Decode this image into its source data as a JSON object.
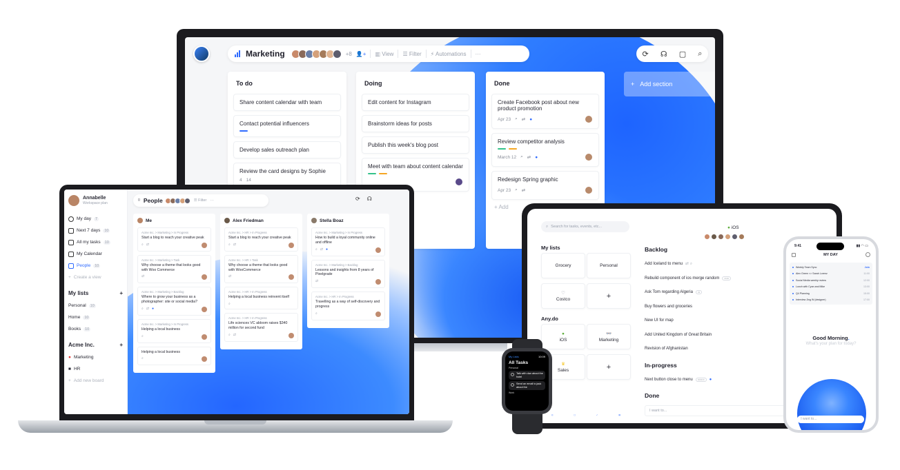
{
  "colors": {
    "accent": "#2f6bff",
    "text": "#1e1e2a",
    "muted": "#9aa0ad"
  },
  "monitor": {
    "project_title": "Marketing",
    "more_members": "+8",
    "view_label": "View",
    "filter_label": "Filter",
    "automations_label": "Automations",
    "more_label": "···",
    "add_section_label": "Add section",
    "columns": [
      {
        "title": "To do",
        "cards": [
          {
            "text": "Share content calendar with team"
          },
          {
            "text": "Contact potential influencers"
          },
          {
            "text": "Develop sales outreach plan"
          },
          {
            "text": "Review the card designs by Sophie",
            "meta1": "4",
            "meta2": "14"
          }
        ]
      },
      {
        "title": "Doing",
        "cards": [
          {
            "text": "Edit content for Instagram"
          },
          {
            "text": "Brainstorm ideas for posts"
          },
          {
            "text": "Publish this week's blog post"
          },
          {
            "text": "Meet with team about content calendar"
          }
        ]
      },
      {
        "title": "Done",
        "cards": [
          {
            "text": "Create Facebook post about new product promotion",
            "date": "Apr 23"
          },
          {
            "text": "Review competitor analysis",
            "date": "March 12"
          },
          {
            "text": "Redesign Spring graphic",
            "date": "Apr 23"
          }
        ],
        "add_label": "Add"
      }
    ]
  },
  "laptop": {
    "user_name": "Annabelle",
    "user_plan": "Workspace plan",
    "nav": [
      {
        "label": "My day",
        "count": "7"
      },
      {
        "label": "Next 7 days",
        "count": "10"
      },
      {
        "label": "All my tasks",
        "count": "10"
      },
      {
        "label": "My Calendar",
        "count": ""
      },
      {
        "label": "People",
        "count": "10"
      },
      {
        "label": "Create a view",
        "count": ""
      }
    ],
    "my_lists_title": "My lists",
    "my_lists": [
      {
        "label": "Personal",
        "count": "10"
      },
      {
        "label": "Home",
        "count": "10"
      },
      {
        "label": "Books",
        "count": "10"
      }
    ],
    "workspace_title": "Acme Inc.",
    "workspace_items": [
      {
        "label": "Marketing"
      },
      {
        "label": "HR"
      },
      {
        "label": "Add new board"
      }
    ],
    "board_title": "People",
    "filter_label": "Filter",
    "more_label": "···",
    "columns": [
      {
        "person": "Me",
        "cards": [
          {
            "crumb": "Acme Inc. > Marketing > In Progress",
            "text": "Start a blog to reach your creative peak"
          },
          {
            "crumb": "Acme Inc. > Marketing > Task",
            "text": "Why choose a theme that looks good with Woo Commerce"
          },
          {
            "crumb": "Acme Inc. > Marketing > Backlog",
            "text": "Where to grow your business as a photographer: site or social media?"
          },
          {
            "crumb": "Acme Inc. > Marketing > In Progress",
            "text": "Helping a local business"
          },
          {
            "crumb": "",
            "text": "Helping a local business"
          }
        ]
      },
      {
        "person": "Alex Friedman",
        "cards": [
          {
            "crumb": "Acme Inc. > HR > In Progress",
            "text": "Start a blog to reach your creative peak"
          },
          {
            "crumb": "Acme Inc. > HR > Task",
            "text": "Why choose a theme that looks good with WooCommerce"
          },
          {
            "crumb": "Acme Inc. > HR > In Progress",
            "text": "Helping a local business reinvent itself"
          },
          {
            "crumb": "Acme Inc. > HR > In Progress",
            "text": "Life sciences VC abloom raises $340 million for second fund"
          }
        ]
      },
      {
        "person": "Stella Boaz",
        "cards": [
          {
            "crumb": "Acme Inc. > Marketing > In Progress",
            "text": "How to build a loyal community online and offline"
          },
          {
            "crumb": "Acme Inc. > Marketing > Backlog",
            "text": "Lessons and insights from 8 years of Pixelgrade"
          },
          {
            "crumb": "Acme Inc. > HR > In Progress",
            "text": "Travelling as a way of self-discovery and progress"
          }
        ]
      }
    ]
  },
  "tablet": {
    "search_placeholder": "Search for tasks, events, etc...",
    "my_lists_title": "My lists",
    "my_lists": [
      "Grocery",
      "Personal",
      "Costco"
    ],
    "workspace_title": "Any.do",
    "workspace_lists": [
      "iOS",
      "Marketing",
      "Sales"
    ],
    "add_symbol": "+",
    "board_title": "iOS",
    "backlog_title": "Backlog",
    "backlog": [
      "Add Iceland to menu",
      "Rebuild component of ios merge random",
      "Ask Tom regarding Algeria",
      "Buy flowers and groceries",
      "New UI for map",
      "Add United Kingdom of Great Britain",
      "Revision of Afghanistan"
    ],
    "inprogress_title": "In-progress",
    "inprogress": [
      "Next button close to menu"
    ],
    "done_title": "Done",
    "input_placeholder": "I want to..."
  },
  "watch": {
    "app": "My Lists",
    "time": "10:09",
    "title": "All Tasks",
    "section": "Personal",
    "tasks": [
      "Talk with dan about the hotel",
      "Send an email to jack about the"
    ],
    "section2": "Work"
  },
  "phone": {
    "time": "9:41",
    "title": "MY DAY",
    "events": [
      {
        "label": "Weekly Team Sync",
        "time": "Join"
      },
      {
        "label": "Alex Green <> Sarah Lorenz",
        "time": "11:00"
      },
      {
        "label": "Social Media weekly review",
        "time": "12:00"
      },
      {
        "label": "Lunch with Cyan and Mike",
        "time": "13:00"
      },
      {
        "label": "Q4 Planning",
        "time": "15:00"
      },
      {
        "label": "Interview Jing W (designer)",
        "time": "17:00"
      }
    ],
    "greeting": "Good Morning",
    "question": "What's your plan for today?",
    "input_placeholder": "I want to..."
  }
}
